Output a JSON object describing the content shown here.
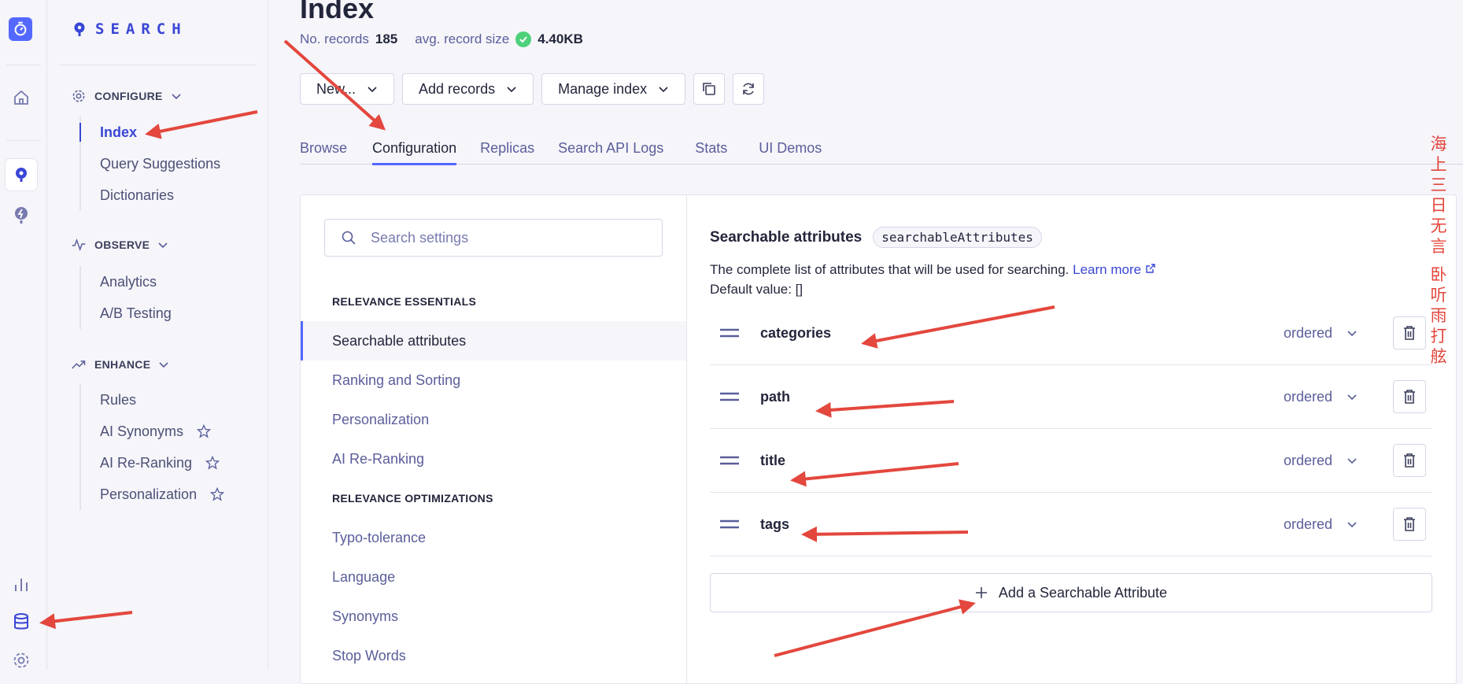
{
  "sidebar": {
    "brand": "SEARCH",
    "sections": [
      {
        "label": "CONFIGURE",
        "items": [
          {
            "label": "Index"
          },
          {
            "label": "Query Suggestions"
          },
          {
            "label": "Dictionaries"
          }
        ]
      },
      {
        "label": "OBSERVE",
        "items": [
          {
            "label": "Analytics"
          },
          {
            "label": "A/B Testing"
          }
        ]
      },
      {
        "label": "ENHANCE",
        "items": [
          {
            "label": "Rules"
          },
          {
            "label": "AI Synonyms"
          },
          {
            "label": "AI Re-Ranking"
          },
          {
            "label": "Personalization"
          }
        ]
      }
    ]
  },
  "header": {
    "title": "Index",
    "records_label": "No. records",
    "records_value": "185",
    "size_label": "avg. record size",
    "size_value": "4.40KB"
  },
  "toolbar": {
    "new_label": "New...",
    "add_label": "Add records",
    "manage_label": "Manage index"
  },
  "tabs": [
    {
      "label": "Browse"
    },
    {
      "label": "Configuration"
    },
    {
      "label": "Replicas"
    },
    {
      "label": "Search API Logs"
    },
    {
      "label": "Stats"
    },
    {
      "label": "UI Demos"
    }
  ],
  "settings": {
    "search_placeholder": "Search settings",
    "groups": [
      {
        "label": "RELEVANCE ESSENTIALS",
        "items": [
          {
            "label": "Searchable attributes"
          },
          {
            "label": "Ranking and Sorting"
          },
          {
            "label": "Personalization"
          },
          {
            "label": "AI Re-Ranking"
          }
        ]
      },
      {
        "label": "RELEVANCE OPTIMIZATIONS",
        "items": [
          {
            "label": "Typo-tolerance"
          },
          {
            "label": "Language"
          },
          {
            "label": "Synonyms"
          },
          {
            "label": "Stop Words"
          }
        ]
      }
    ]
  },
  "content": {
    "heading": "Searchable attributes",
    "code": "searchableAttributes",
    "description": "The complete list of attributes that will be used for searching.",
    "learn_more": "Learn more",
    "default_value": "Default value: []",
    "attributes": [
      {
        "name": "categories",
        "mode": "ordered"
      },
      {
        "name": "path",
        "mode": "ordered"
      },
      {
        "name": "title",
        "mode": "ordered"
      },
      {
        "name": "tags",
        "mode": "ordered"
      }
    ],
    "add_label": "Add a Searchable Attribute"
  },
  "watermark": {
    "line1": "海上三日无言",
    "line2": "卧听雨打舷"
  },
  "colors": {
    "accent": "#5468ff",
    "accent_text": "#3a46d6",
    "annotation": "#e3473d",
    "success": "#4dd17a"
  }
}
